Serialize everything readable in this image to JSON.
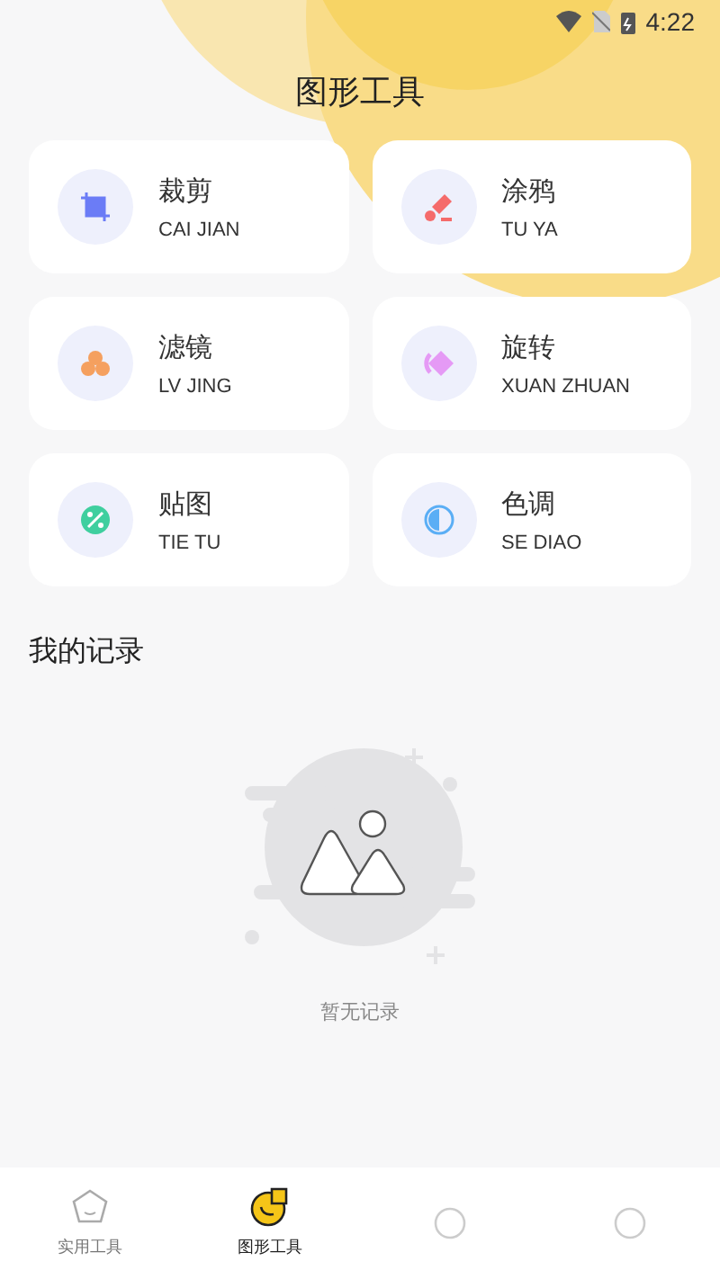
{
  "status_bar": {
    "time": "4:22"
  },
  "header": {
    "title": "图形工具"
  },
  "tools": [
    {
      "kind": "crop",
      "name": "裁剪",
      "pinyin": "CAI JIAN",
      "color": "#6b7cf6"
    },
    {
      "kind": "brush",
      "name": "涂鸦",
      "pinyin": "TU YA",
      "color": "#f56b6b"
    },
    {
      "kind": "filter",
      "name": "滤镜",
      "pinyin": "LV JING",
      "color": "#f5a05f"
    },
    {
      "kind": "rotate",
      "name": "旋转",
      "pinyin": "XUAN ZHUAN",
      "color": "#e59af5"
    },
    {
      "kind": "sticker",
      "name": "贴图",
      "pinyin": "TIE TU",
      "color": "#3fcf9f"
    },
    {
      "kind": "tone",
      "name": "色调",
      "pinyin": "SE DIAO",
      "color": "#5aaef5"
    }
  ],
  "records": {
    "title": "我的记录",
    "empty_text": "暂无记录"
  },
  "bottom_nav": [
    {
      "kind": "home",
      "label": "实用工具",
      "selected": false
    },
    {
      "kind": "chart",
      "label": "图形工具",
      "selected": true
    },
    {
      "kind": "blank",
      "selected": false
    },
    {
      "kind": "blank",
      "selected": false
    }
  ]
}
